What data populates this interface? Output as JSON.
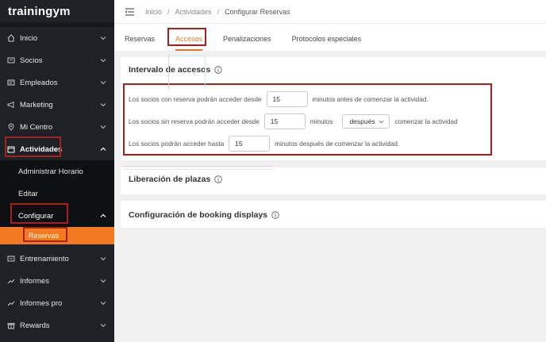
{
  "brand": {
    "name": "trainingym"
  },
  "sidebar": {
    "items": [
      {
        "label": "Inicio",
        "icon": "home-icon"
      },
      {
        "label": "Socios",
        "icon": "id-card-icon"
      },
      {
        "label": "Empleados",
        "icon": "employees-icon"
      },
      {
        "label": "Marketing",
        "icon": "megaphone-icon"
      },
      {
        "label": "Mi Centro",
        "icon": "location-pin-icon"
      },
      {
        "label": "Actividades",
        "icon": "calendar-icon"
      }
    ],
    "actividades_sub": [
      {
        "label": "Administrar Horario"
      },
      {
        "label": "Editar"
      },
      {
        "label": "Configurar"
      }
    ],
    "configurar_sub": [
      {
        "label": "Reservas"
      }
    ],
    "items_after": [
      {
        "label": "Entrenamiento",
        "icon": "dumbbell-icon"
      },
      {
        "label": "Informes",
        "icon": "chart-line-icon"
      },
      {
        "label": "Informes pro",
        "icon": "chart-line-icon"
      },
      {
        "label": "Rewards",
        "icon": "gift-icon"
      }
    ]
  },
  "breadcrumb": [
    "Inicio",
    "Actividades",
    "Configurar Reservas"
  ],
  "breadcrumb_sep": "/",
  "tabs": [
    {
      "label": "Reservas"
    },
    {
      "label": "Accesos"
    },
    {
      "label": "Penalizaciones"
    },
    {
      "label": "Protocolos especiales"
    }
  ],
  "intervalo": {
    "title": "Intervalo de accesos",
    "row1": {
      "before": "Los socios con reserva podrán acceder desde",
      "value": "15",
      "after": "minutos antes de comenzar la actividad."
    },
    "row2": {
      "before": "Los socios sin reserva podrán acceder desde",
      "value": "15",
      "middle": "minutos",
      "select": "después",
      "after": "comenzar la actividad"
    },
    "row3": {
      "before": "Los socios podrán acceder hasta",
      "value": "15",
      "after": "minutos después de comenzar la actividad."
    }
  },
  "liberacion": {
    "title": "Liberación de plazas"
  },
  "booking": {
    "title": "Configuración de booking displays"
  },
  "colors": {
    "sidebar_bg": "#1e2126",
    "accent": "#f47921",
    "highlight_box": "#a8201e",
    "tab_active": "#e07b1e"
  }
}
